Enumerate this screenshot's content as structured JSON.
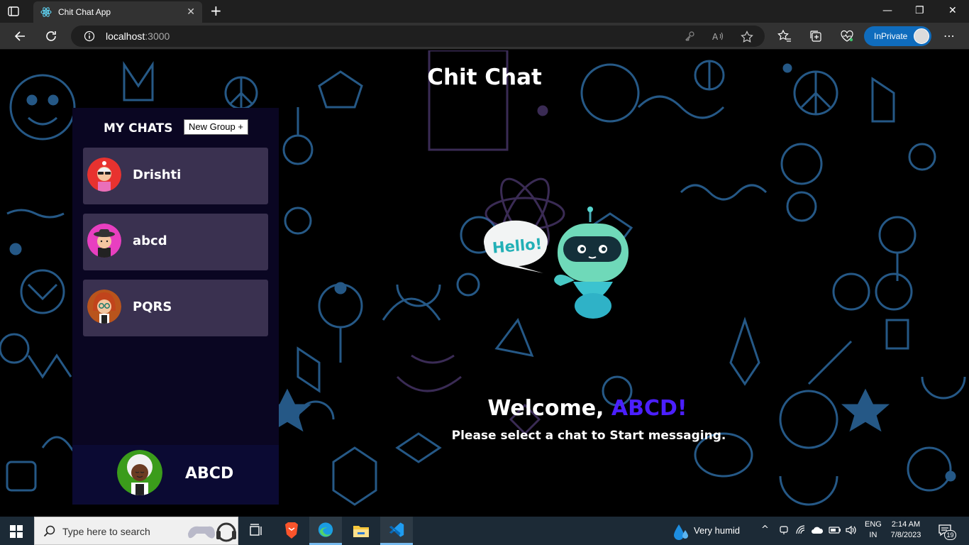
{
  "browser": {
    "tab_title": "Chit Chat App",
    "url_host": "localhost",
    "url_port": ":3000",
    "inprivate_label": "InPrivate"
  },
  "app": {
    "title": "Chit Chat",
    "sidebar": {
      "heading": "MY CHATS",
      "new_group_label": "New Group +",
      "chats": [
        {
          "name": "Drishti"
        },
        {
          "name": "abcd"
        },
        {
          "name": "PQRS"
        }
      ],
      "current_user": "ABCD"
    },
    "welcome": {
      "greeting": "Welcome, ",
      "name": "ABCD!",
      "subtext": "Please select a chat to Start messaging.",
      "bubble_text": "Hello!"
    }
  },
  "taskbar": {
    "search_placeholder": "Type here to search",
    "weather": "Very humid",
    "lang_line1": "ENG",
    "lang_line2": "IN",
    "time": "2:14 AM",
    "date": "7/8/2023",
    "notification_count": "19"
  },
  "colors": {
    "accent_name": "#4b1fff",
    "sidebar_bg": "#0a0622",
    "chat_item_bg": "#3a3150",
    "inprivate_bg": "#0f6cbd"
  }
}
